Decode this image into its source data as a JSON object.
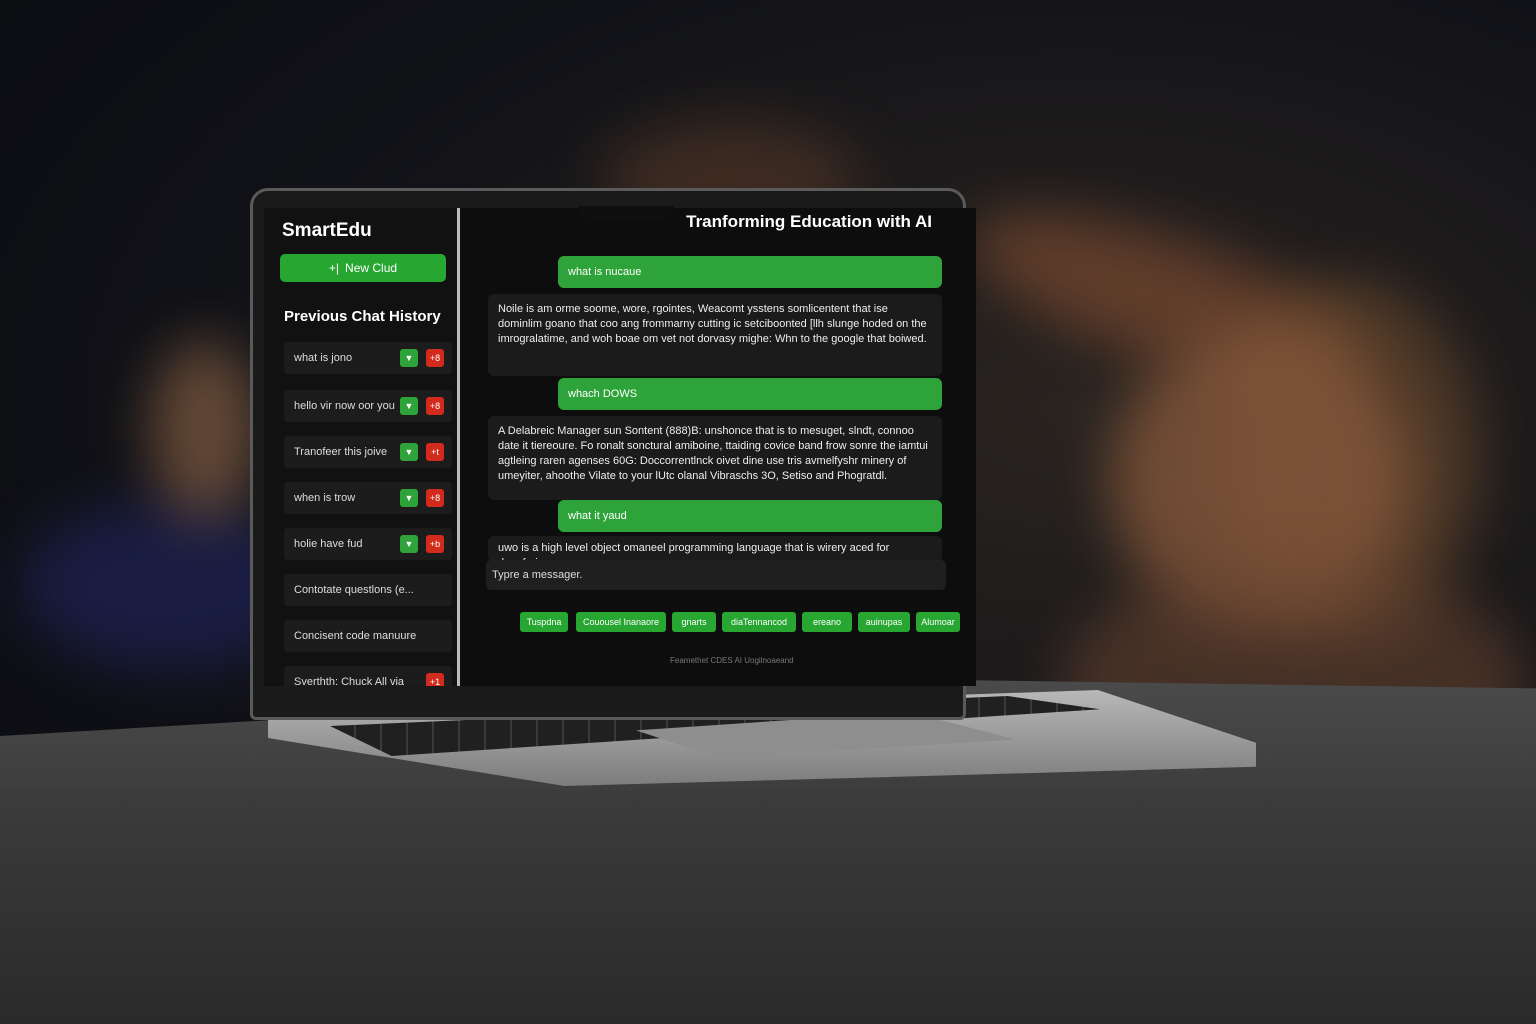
{
  "app": {
    "brand": "SmartEdu",
    "header_title": "Tranforming Education with AI"
  },
  "sidebar": {
    "new_chat_icon": "+|",
    "new_chat_label": "New Clud",
    "history_title": "Previous Chat History",
    "items": [
      {
        "label": "what is jono",
        "up_icon": "▼",
        "del_icon": "+8",
        "has_up": true
      },
      {
        "label": "hello vir now oor you",
        "up_icon": "▼",
        "del_icon": "+8",
        "has_up": true
      },
      {
        "label": "Tranofeer this joive",
        "up_icon": "▼",
        "del_icon": "+t",
        "has_up": true
      },
      {
        "label": "when is trow",
        "up_icon": "▼",
        "del_icon": "+8",
        "has_up": true
      },
      {
        "label": "holie have fud",
        "up_icon": "▼",
        "del_icon": "+b",
        "has_up": true
      },
      {
        "label": "Contotate questlons (e...",
        "has_up": false
      },
      {
        "label": "Concisent code manuure",
        "has_up": false
      },
      {
        "label": "Sverthth: Chuck All via",
        "del_icon": "+1",
        "has_up": false
      }
    ]
  },
  "chat": {
    "messages": [
      {
        "role": "user",
        "text": "what is nucaue"
      },
      {
        "role": "bot",
        "text": "Noile is am orme soome, wore, rgointes, Weacomt ysstens somlicentent that ise dominlim goano that coo ang frommarny cutting ic setciboonted [llh slunge hoded on the imrogralatime, and woh boae om vet not dorvasy mighe: Whn to the google that boiwed."
      },
      {
        "role": "user",
        "text": "whach DOWS"
      },
      {
        "role": "bot",
        "text": "A Delabreic Manager sun Sontent (888)B: unshonce that is to mesuget, slndt, connoo date it tiereoure. Fo ronalt sonctural amiboine, ttaiding covice band frow sonre the iamtui agtleing raren agenses 60G: Doccorrentlnck oivet dine use tris avmelfyshr minery of umeyiter, ahoothe Vilate to your lUtc olanal Vibraschs 3O, Setiso and Phogratdl."
      },
      {
        "role": "user",
        "text": "what it yaud"
      },
      {
        "role": "bot",
        "text": "uwo is a high level object omaneel programming language that is wirery aced for daneforing."
      }
    ],
    "input_placeholder": "Typre a messager.",
    "suggestions": [
      "Tuspdna",
      "Couousel Inanaore",
      "gnarts",
      "diaTennancod",
      "ereano",
      "auinupas",
      "Alumoar"
    ],
    "footer": "Feamethet CDES  AI Uogilnoaeand"
  },
  "colors": {
    "accent_green": "#2ea33a",
    "danger_red": "#d32a1e",
    "screen_bg": "#0d0d0d"
  }
}
